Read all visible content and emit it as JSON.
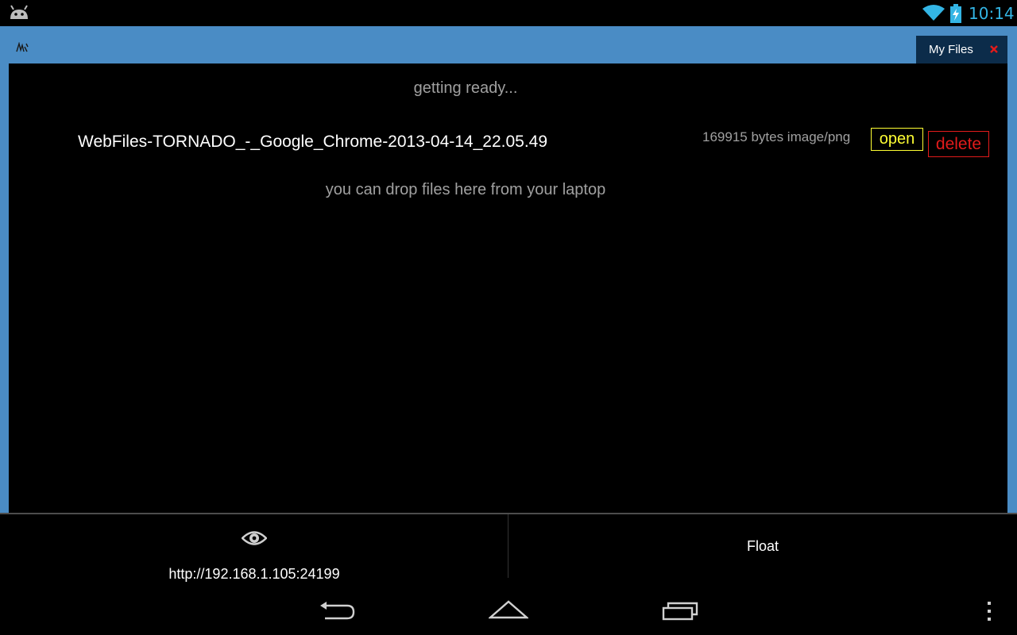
{
  "status_bar": {
    "time": "10:14",
    "icons": [
      "android-icon",
      "wifi-icon",
      "battery-charging-icon"
    ]
  },
  "window": {
    "tab_label": "My Files",
    "colors": {
      "frame": "#4a8cc5",
      "tab_bg": "#0c2c4a",
      "close": "#e21b1b"
    }
  },
  "content": {
    "status_text": "getting ready...",
    "files": [
      {
        "name": "WebFiles-TORNADO_-_Google_Chrome-2013-04-14_22.05.49",
        "meta": "169915 bytes image/png",
        "open_label": "open",
        "delete_label": "delete"
      }
    ],
    "drop_hint": "you can drop files here from your laptop"
  },
  "action_bar": {
    "url": "http://192.168.1.105:24199",
    "float_label": "Float"
  },
  "nav_bar": {
    "icons": [
      "back-icon",
      "home-icon",
      "recents-icon",
      "overflow-menu-icon"
    ]
  },
  "colors": {
    "accent_blue": "#33b5e5",
    "open": "#ffff33",
    "delete": "#e21b1b",
    "muted_text": "#a0a0a0"
  }
}
